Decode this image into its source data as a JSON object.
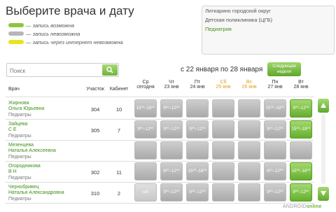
{
  "page_title": "Выберите врача и дату",
  "legend": [
    {
      "text": "— запись возможна",
      "color": "#8cc63f"
    },
    {
      "text": "— запись невозможна",
      "color": "#b7b7b7"
    },
    {
      "text": "— запись через интернет невозможна",
      "color": "#e8e61a"
    }
  ],
  "info": {
    "line1": "Литкарино городской округ",
    "line2": "Детская поликлиника (ЦГБ)",
    "line3": "Педиатрия"
  },
  "search": {
    "placeholder": "Поиск",
    "icon": "search-icon"
  },
  "date_range": "с 22 января по 28 января",
  "next_week": {
    "line1": "Следующая",
    "line2": "неделя"
  },
  "columns": {
    "doctor": "Врач",
    "area": "Участок",
    "cabinet": "Кабинет",
    "days": [
      {
        "d1": "Ср",
        "d2": "сегодня",
        "weekend": false
      },
      {
        "d1": "Чт",
        "d2": "23 янв",
        "weekend": false
      },
      {
        "d1": "Пт",
        "d2": "24 янв",
        "weekend": false
      },
      {
        "d1": "Сб",
        "d2": "25 янв",
        "weekend": true
      },
      {
        "d1": "Вс",
        "d2": "26 янв",
        "weekend": true
      },
      {
        "d1": "Пн",
        "d2": "27 янв",
        "weekend": false
      },
      {
        "d1": "Вт",
        "d2": "28 янв",
        "weekend": false
      }
    ]
  },
  "doctors": [
    {
      "name1": "Жирнова",
      "name2": "Ольга Юрьевна",
      "spec": "Педиатры",
      "area": "304",
      "cabinet": "10",
      "slots": [
        {
          "t": "15⁰⁰–18⁰⁰",
          "s": "gray"
        },
        {
          "t": "9⁰⁰–12⁰⁰",
          "s": "gray"
        },
        {
          "t": "",
          "s": "gray"
        },
        {
          "t": "",
          "s": "gray"
        },
        {
          "t": "",
          "s": "gray"
        },
        {
          "t": "15⁰⁰–18⁰⁰",
          "s": "gray"
        },
        {
          "t": "9⁰⁰–12⁰⁰",
          "s": "green"
        }
      ]
    },
    {
      "name1": "Зайцева",
      "name2": "С Е",
      "spec": "Педиатры",
      "area": "305",
      "cabinet": "7",
      "slots": [
        {
          "t": "9⁰⁰–12⁰⁰",
          "s": "gray"
        },
        {
          "t": "9⁰⁰–12⁰⁰",
          "s": "gray"
        },
        {
          "t": "9⁰⁰–12⁰⁰",
          "s": "gray"
        },
        {
          "t": "",
          "s": "gray"
        },
        {
          "t": "",
          "s": "gray"
        },
        {
          "t": "9⁰⁰–12⁰⁰",
          "s": "gray"
        },
        {
          "t": "15⁰⁰–18⁰⁰",
          "s": "green"
        }
      ]
    },
    {
      "name1": "Мезенцева",
      "name2": "Наталья Алексеевна",
      "spec": "Педиатры",
      "area": "",
      "cabinet": "",
      "slots": [
        {
          "t": "",
          "s": "gray"
        },
        {
          "t": "",
          "s": "gray"
        },
        {
          "t": "",
          "s": "gray"
        },
        {
          "t": "",
          "s": "gray"
        },
        {
          "t": "",
          "s": "gray"
        },
        {
          "t": "",
          "s": "gray"
        },
        {
          "t": "",
          "s": "gray"
        }
      ]
    },
    {
      "name1": "Огородникова",
      "name2": "В Н",
      "spec": "Педиатры",
      "area": "302",
      "cabinet": "11",
      "slots": [
        {
          "t": "",
          "s": "gray"
        },
        {
          "t": "8⁰⁰–12⁰⁰",
          "s": "gray"
        },
        {
          "t": "15⁰⁰–18⁰⁰",
          "s": "gray"
        },
        {
          "t": "",
          "s": "gray"
        },
        {
          "t": "",
          "s": "gray"
        },
        {
          "t": "8⁰⁰–12⁰⁰",
          "s": "gray"
        },
        {
          "t": "15⁰⁰–18⁰⁰",
          "s": "green"
        }
      ]
    },
    {
      "name1": "Чернобривец",
      "name2": "Наталья Александровна",
      "spec": "Педиатры",
      "area": "310",
      "cabinet": "2",
      "slots": [
        {
          "t": "н/п",
          "s": "light"
        },
        {
          "t": "9⁰⁰–12⁰⁰",
          "s": "gray"
        },
        {
          "t": "9⁰⁰–12⁰⁰",
          "s": "gray"
        },
        {
          "t": "",
          "s": "gray"
        },
        {
          "t": "",
          "s": "gray"
        },
        {
          "t": "9⁰⁰–12⁰⁰",
          "s": "gray"
        },
        {
          "t": "9⁰⁰–12⁰⁰",
          "s": "green"
        }
      ]
    }
  ],
  "footer": {
    "brand_a": "ANDROID",
    "brand_b": "online"
  }
}
